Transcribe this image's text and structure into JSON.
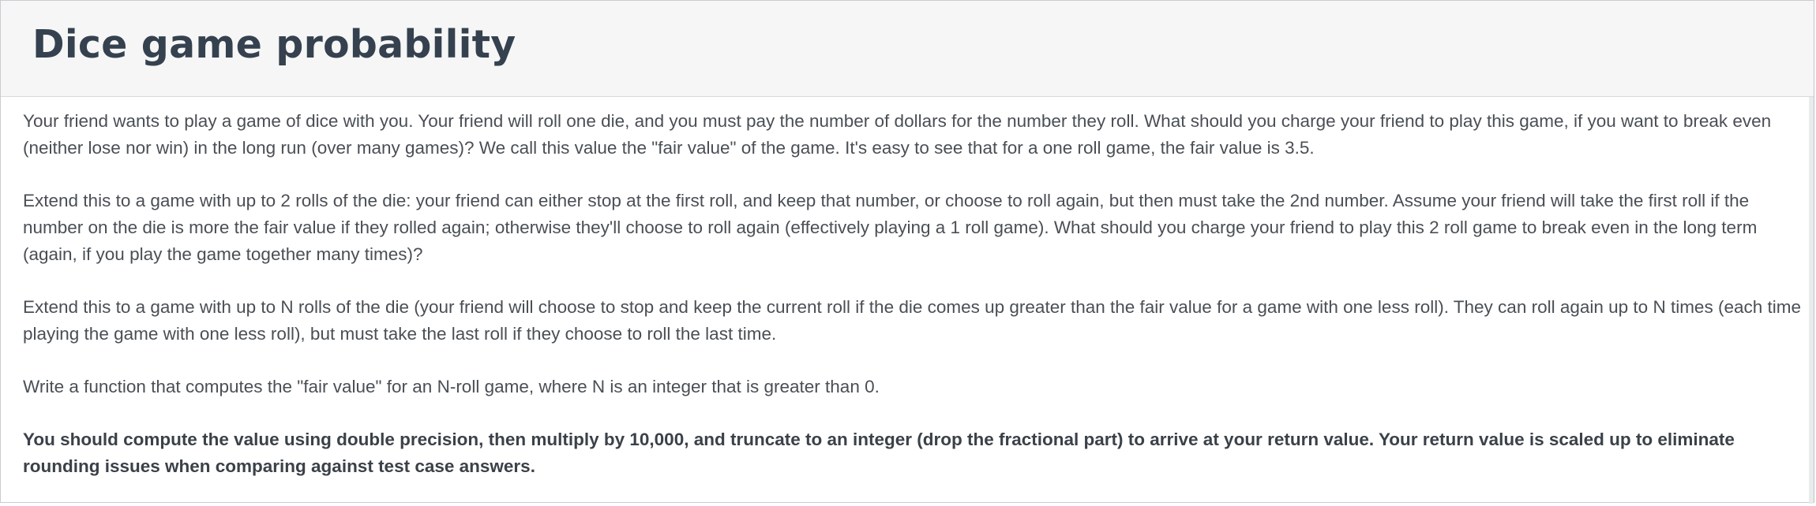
{
  "header": {
    "title": "Dice game probability"
  },
  "content": {
    "paragraphs": [
      "Your friend wants to play a game of dice with you.  Your friend will roll one die, and you must pay the number of dollars for the number they roll. What should you charge your friend to play this game, if you want to break even (neither lose nor win) in the long run (over many games)?  We call this value the \"fair value\" of the game.  It's easy to see that for a one roll game, the fair value is 3.5.",
      "Extend this to a game with up to 2 rolls of the die:  your friend can either stop at the first roll, and keep that number, or choose to roll again, but then must take the 2nd number.  Assume your friend will take the first roll if the number on the die is more the fair value if they rolled again; otherwise they'll choose to roll again (effectively playing a 1 roll game).  What should you charge your friend to play this 2 roll game to break even in the long term (again, if you play the game together many times)?",
      "Extend this to a game with up to N rolls of the die (your friend will choose to stop and keep the current roll if the die comes up greater than the fair value for a game with one less roll).  They can roll again up to N times (each time playing the game with one less roll), but must take the last roll if they choose to roll the last time.",
      "Write a function that computes the \"fair value\" for an N-roll game, where N is an integer that is greater than 0."
    ],
    "bold_note": "You should compute the value using double precision, then multiply by 10,000, and truncate to an integer (drop the fractional part) to arrive at your return value.  Your return value is scaled up to eliminate rounding issues when comparing against test case answers."
  }
}
